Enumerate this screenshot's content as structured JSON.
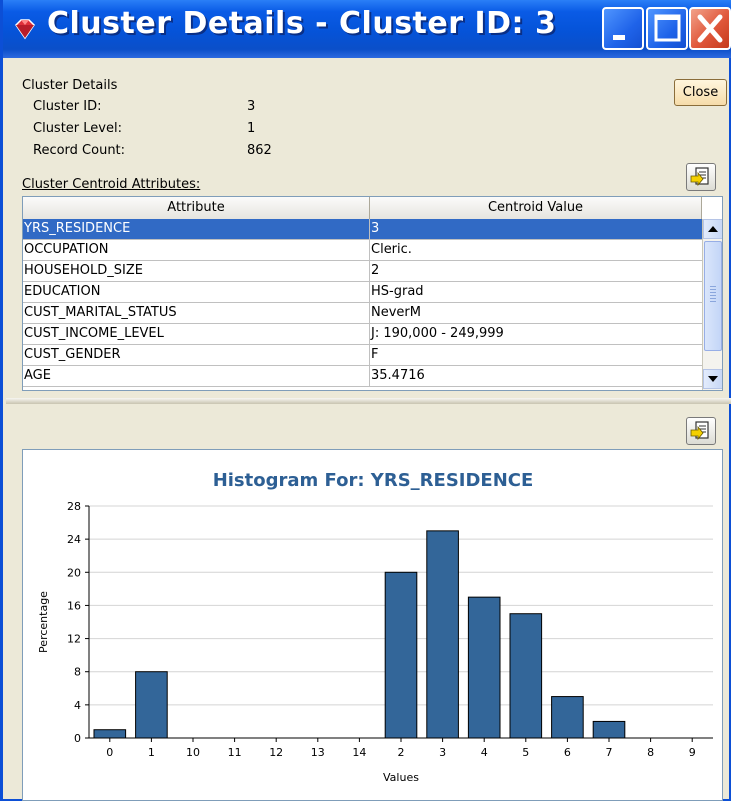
{
  "window": {
    "title": "Cluster Details - Cluster ID: 3",
    "title_icon": "gem-icon"
  },
  "details": {
    "section_label": "Cluster Details",
    "fields": [
      {
        "label": "Cluster ID:",
        "value": "3"
      },
      {
        "label": "Cluster Level:",
        "value": "1"
      },
      {
        "label": "Record Count:",
        "value": "862"
      }
    ]
  },
  "close_label": "Close",
  "centroid": {
    "label": "Cluster Centroid Attributes:",
    "columns": [
      "Attribute",
      "Centroid Value"
    ],
    "rows": [
      {
        "attribute": "YRS_RESIDENCE",
        "value": "3",
        "selected": true
      },
      {
        "attribute": "OCCUPATION",
        "value": "Cleric."
      },
      {
        "attribute": "HOUSEHOLD_SIZE",
        "value": "2"
      },
      {
        "attribute": "EDUCATION",
        "value": "HS-grad"
      },
      {
        "attribute": "CUST_MARITAL_STATUS",
        "value": "NeverM"
      },
      {
        "attribute": "CUST_INCOME_LEVEL",
        "value": "J: 190,000 - 249,999"
      },
      {
        "attribute": "CUST_GENDER",
        "value": "F"
      },
      {
        "attribute": "AGE",
        "value": "35.4716"
      }
    ]
  },
  "colors": {
    "bar": "#336699",
    "selection": "#316ac5",
    "chart_title": "#2d5f94"
  },
  "chart_data": {
    "type": "bar",
    "title": "Histogram For: YRS_RESIDENCE",
    "xlabel": "Values",
    "ylabel": "Percentage",
    "categories": [
      "0",
      "1",
      "10",
      "11",
      "12",
      "13",
      "14",
      "2",
      "3",
      "4",
      "5",
      "6",
      "7",
      "8",
      "9"
    ],
    "values": [
      1,
      8,
      0,
      0,
      0,
      0,
      0,
      20,
      25,
      17,
      15,
      5,
      2,
      0,
      0
    ],
    "ylim": [
      0,
      28
    ],
    "yticks": [
      0,
      4,
      8,
      12,
      16,
      20,
      24,
      28
    ],
    "grid": true
  }
}
